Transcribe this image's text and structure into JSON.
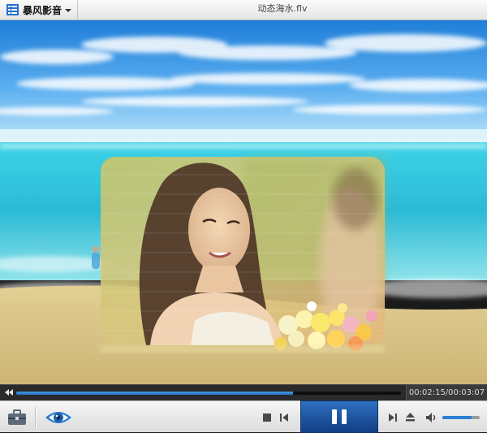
{
  "app": {
    "brand_name": "暴风影音",
    "file_title": "动态海水.flv"
  },
  "playback": {
    "current_time": "00:02:15",
    "total_time": "00:03:07",
    "time_display": "00:02:15/00:03:07",
    "progress": 0.72,
    "state": "playing",
    "volume": 0.78
  },
  "icons": {
    "brand": "list-logo-icon",
    "menu": "caret-down-icon",
    "rewind": "rewind-icon",
    "fast_forward": "fast-forward-icon",
    "toolbox": "toolbox-icon",
    "view": "eye-icon",
    "stop": "stop-icon",
    "prev": "previous-icon",
    "pause": "pause-icon",
    "next": "next-icon",
    "eject": "eject-icon",
    "volume": "speaker-icon"
  },
  "colors": {
    "accent": "#1f6ec1",
    "play_button": "#123f83"
  }
}
